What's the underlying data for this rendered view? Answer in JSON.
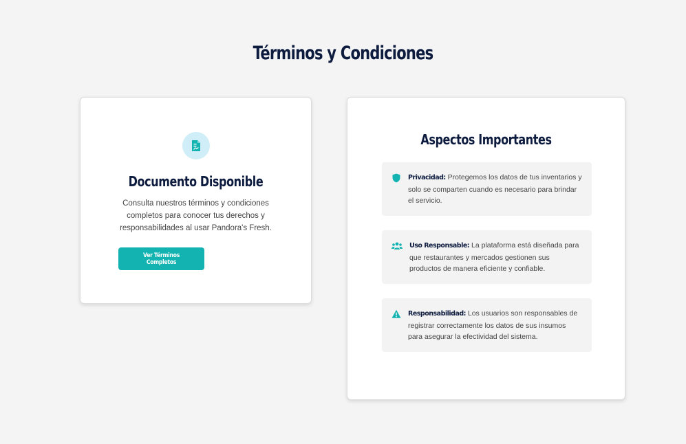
{
  "page": {
    "title": "Términos y Condiciones"
  },
  "document_card": {
    "icon": "document-icon",
    "heading": "Documento Disponible",
    "description": "Consulta nuestros términos y condiciones completos para conocer tus derechos y responsabilidades al usar Pandora's Fresh.",
    "button_label": "Ver Términos Completos"
  },
  "aspects_card": {
    "heading": "Aspectos Importantes",
    "items": [
      {
        "icon": "shield-icon",
        "label": "Privacidad:",
        "text": " Protegemos los datos de tus inventarios y solo se comparten cuando es necesario para brindar el servicio."
      },
      {
        "icon": "users-icon",
        "label": "Uso Responsable:",
        "text": " La plataforma está diseñada para que restaurantes y mercados gestionen sus productos de manera eficiente y confiable."
      },
      {
        "icon": "warning-icon",
        "label": "Responsabilidad:",
        "text": " Los usuarios son responsables de registrar correctamente los datos de sus insumos para asegurar la efectividad del sistema."
      }
    ]
  },
  "colors": {
    "accent": "#12b3b0",
    "heading": "#0d1b3e",
    "background": "#f4f4f4",
    "icon_circle": "#cfeef8"
  }
}
